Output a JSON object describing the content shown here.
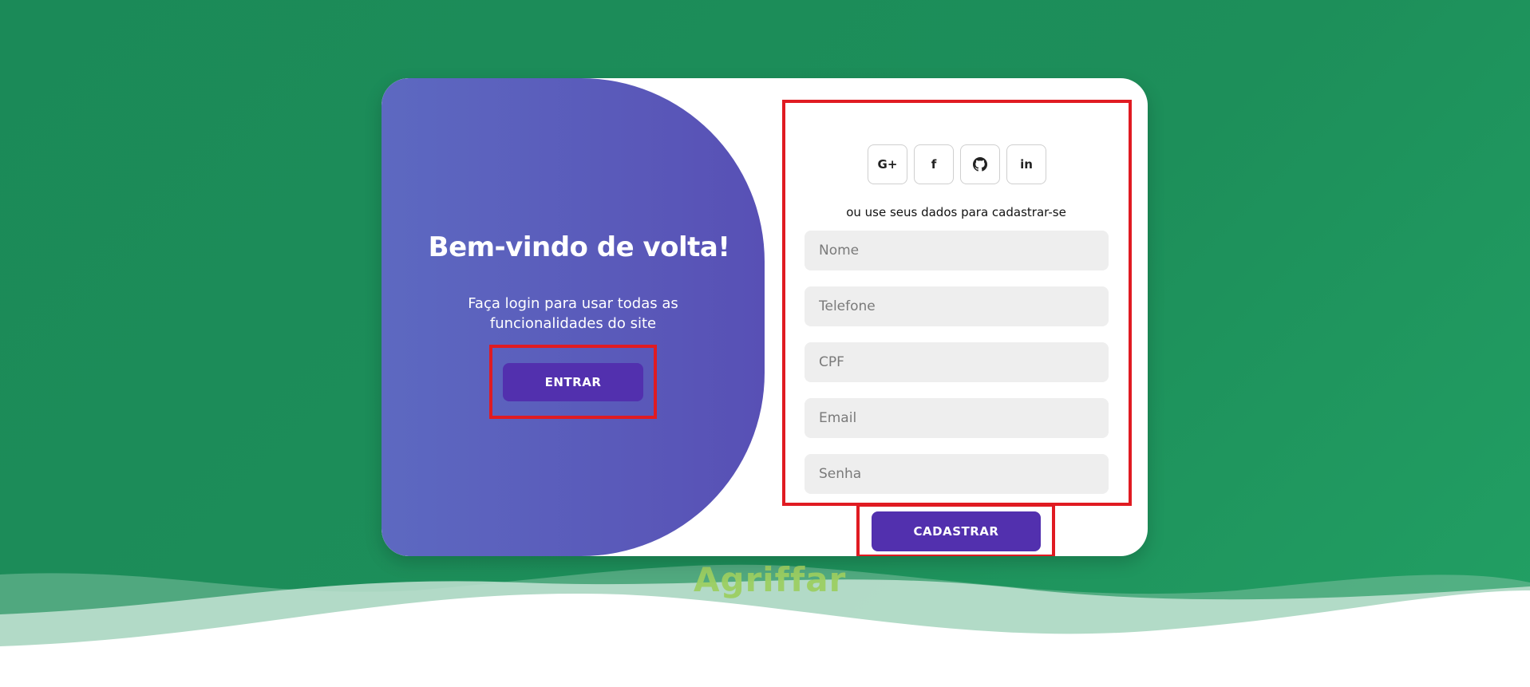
{
  "brand": {
    "name": "Agriffar"
  },
  "welcome": {
    "title": "Bem-vindo de volta!",
    "text": "Faça login para usar todas as funcionalidades do site",
    "button_label": "ENTRAR"
  },
  "register": {
    "social": [
      {
        "label": "G+",
        "icon": "google-plus-icon"
      },
      {
        "label": "f",
        "icon": "facebook-icon"
      },
      {
        "label": "",
        "icon": "github-icon"
      },
      {
        "label": "in",
        "icon": "linkedin-icon"
      }
    ],
    "divider_text": "ou use seus dados para cadastrar-se",
    "fields": {
      "nome": {
        "placeholder": "Nome",
        "value": ""
      },
      "telefone": {
        "placeholder": "Telefone",
        "value": ""
      },
      "cpf": {
        "placeholder": "CPF",
        "value": ""
      },
      "email": {
        "placeholder": "Email",
        "value": ""
      },
      "senha": {
        "placeholder": "Senha",
        "value": ""
      }
    },
    "button_label": "CADASTRAR"
  },
  "colors": {
    "background": "#1d8f5a",
    "panel_gradient_start": "#5d69c1",
    "panel_gradient_end": "#5850b5",
    "button": "#5230ae",
    "highlight": "#e01b22",
    "brand_text": "#9ccf62"
  }
}
